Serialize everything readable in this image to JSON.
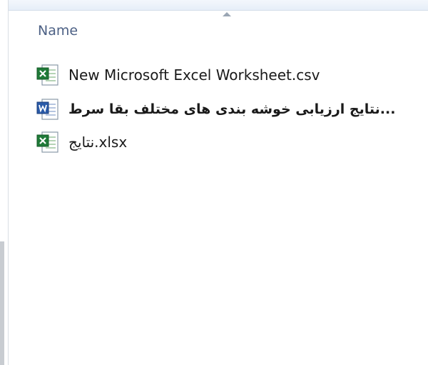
{
  "column": {
    "name_label": "Name",
    "sort_indicator": "ascending-arrow-icon"
  },
  "files": [
    {
      "name": "New Microsoft Excel Worksheet.csv",
      "icon": "excel-file-icon"
    },
    {
      "name": "...نتایج ارزیابی خوشه بندی های مختلف بقا سرط",
      "icon": "word-file-icon"
    },
    {
      "name": "نتایج.xlsx",
      "icon": "excel-file-icon"
    }
  ],
  "colors": {
    "header_text": "#4d6185",
    "excel_green": "#1f7a38",
    "word_blue": "#2a5aa8"
  }
}
